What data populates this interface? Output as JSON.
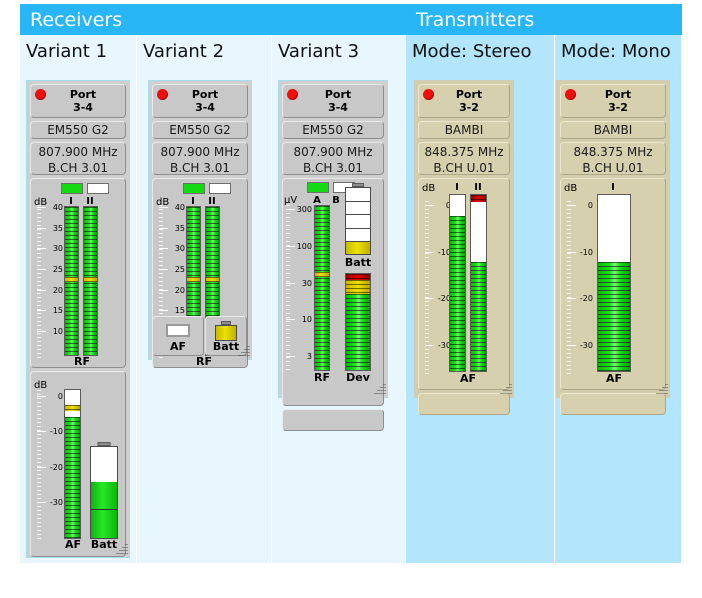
{
  "groups": {
    "receivers": {
      "label": "Receivers",
      "accent": "#29b6f6"
    },
    "transmitters": {
      "label": "Transmitters",
      "accent": "#29b6f6"
    }
  },
  "columns": [
    {
      "title": "Variant 1"
    },
    {
      "title": "Variant 2"
    },
    {
      "title": "Variant 3"
    },
    {
      "title": "Mode: Stereo"
    },
    {
      "title": "Mode: Mono"
    }
  ],
  "variant1": {
    "port_line1": "Port",
    "port_line2": "3-4",
    "device_name": "EM550 G2",
    "frequency": "807.900 MHz",
    "bank_channel": "B.CH   3.01",
    "rf": {
      "unit": "dB",
      "ticks": [
        "40",
        "35",
        "30",
        "25",
        "20",
        "15",
        "10"
      ],
      "channel_a": "I",
      "channel_b": "II",
      "label": "RF",
      "value_a": 100,
      "value_b": 100,
      "peak_a": 25,
      "peak_b": 25
    },
    "af": {
      "unit": "dB",
      "ticks": [
        "0",
        "-10",
        "-20",
        "-30"
      ],
      "label": "AF",
      "level": 82,
      "peak": 88
    },
    "battery": {
      "label": "Batt",
      "level": 62,
      "color": "#1fd81f"
    }
  },
  "variant2": {
    "port_line1": "Port",
    "port_line2": "3-4",
    "device_name": "EM550 G2",
    "frequency": "807.900 MHz",
    "bank_channel": "B.CH   3.01",
    "rf": {
      "unit": "dB",
      "ticks": [
        "40",
        "35",
        "30",
        "25",
        "20",
        "15",
        "10"
      ],
      "channel_a": "I",
      "channel_b": "II",
      "label": "RF",
      "value_a": 100,
      "value_b": 100,
      "peak_a": 25,
      "peak_b": 25
    },
    "af_mini": {
      "label": "AF"
    },
    "batt_mini": {
      "label": "Batt",
      "level": 100,
      "color": "#ece100"
    }
  },
  "variant3": {
    "port_line1": "Port",
    "port_line2": "3-4",
    "device_name": "EM550 G2",
    "frequency": "807.900 MHz",
    "bank_channel": "B.CH   3.01",
    "rf": {
      "unit": "µV",
      "ticks": [
        "300",
        "100",
        "30",
        "10",
        "3"
      ],
      "channel_a": "A",
      "channel_b": "B",
      "label": "RF",
      "value_a": 100,
      "peak_a": 58
    },
    "battery": {
      "label": "Batt",
      "segments": 5,
      "filled": 1
    },
    "dev": {
      "label": "Dev",
      "level": 100
    }
  },
  "tx_stereo": {
    "port_line1": "Port",
    "port_line2": "3-2",
    "device_name": "BAMBI",
    "frequency": "848.375 MHz",
    "bank_channel": "B.CH   U.01",
    "af": {
      "unit": "dB",
      "ticks": [
        "0",
        "-10",
        "-20",
        "-30"
      ],
      "channel_a": "I",
      "channel_b": "II",
      "label": "AF",
      "value_a": 88,
      "value_b": 62,
      "overload_b": true
    }
  },
  "tx_mono": {
    "port_line1": "Port",
    "port_line2": "3-2",
    "device_name": "BAMBI",
    "frequency": "848.375 MHz",
    "bank_channel": "B.CH   U.01",
    "af": {
      "unit": "dB",
      "ticks": [
        "0",
        "-10",
        "-20",
        "-30"
      ],
      "channel_a": "I",
      "label": "AF",
      "value_a": 62
    }
  }
}
